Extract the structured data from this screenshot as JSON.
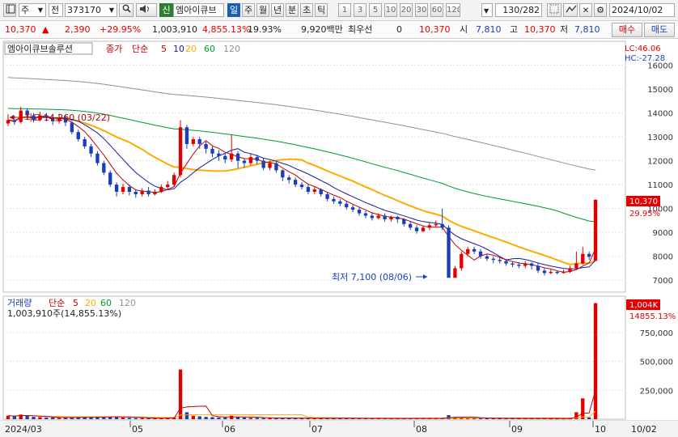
{
  "toolbar": {
    "market": "주",
    "scope": "전",
    "code": "373170",
    "badge": "신",
    "name": "엠아이큐브",
    "periods": [
      "일",
      "주",
      "월",
      "년",
      "분",
      "초",
      "틱"
    ],
    "counts": [
      "1",
      "3",
      "5",
      "10",
      "20",
      "30",
      "60",
      "120"
    ],
    "count_display": "130/282",
    "date": "2024/10/02"
  },
  "quote": {
    "price": "10,370",
    "change": "2,390",
    "change_pct": "+29.95%",
    "volume": "1,003,910",
    "volume_pct": "4,855.13%",
    "turnover": "19.93%",
    "amount": "9,920백만",
    "best_label": "최우선",
    "best_value": "0",
    "last": "10,370",
    "open_label": "시",
    "open": "7,810",
    "high_label": "고",
    "high": "10,370",
    "low_label": "저",
    "low": "7,810",
    "buy": "매수",
    "sell": "매도"
  },
  "chart_data": {
    "type": "candlestick",
    "title": "엠아이큐브솔루션",
    "legend": {
      "kind": "종가",
      "ma": "단순",
      "periods": [
        "5",
        "10",
        "20",
        "60",
        "120"
      ],
      "colors": [
        "#c00000",
        "#1a1aa0",
        "#ffaa00",
        "#009933",
        "#909090"
      ]
    },
    "lc": "LC:46.06",
    "hc": "HC:-27.28",
    "y_ticks": [
      7000,
      8000,
      9000,
      10000,
      11000,
      12000,
      13000,
      14000,
      15000,
      16000
    ],
    "ylim": [
      6500,
      17000
    ],
    "price_label": "10,370",
    "price_pct": "29.95%",
    "high_annotation": "최고 14,260 (03/22)",
    "low_annotation": "최저 7,100 (08/06)",
    "x_labels": [
      "2024/03",
      "05",
      "06",
      "07",
      "08",
      "09",
      "10",
      "10/02"
    ],
    "volume_panel": {
      "title": "거래량",
      "ma": "단순",
      "periods": [
        "5",
        "20",
        "60",
        "120"
      ],
      "colors": [
        "#c00000",
        "#ffaa00",
        "#009933",
        "#909090"
      ],
      "summary": "1,003,910주(14,855.13%)",
      "y_ticks": [
        "250,000",
        "500,000",
        "750,000"
      ],
      "tick_values": [
        250000,
        500000,
        750000
      ],
      "max_label": "1,004K",
      "max_pct": "14855.13%",
      "ylim": [
        0,
        1050000
      ]
    },
    "candles": [
      [
        13560,
        13700,
        13950,
        13450
      ],
      [
        13700,
        13620,
        13900,
        13500
      ],
      [
        13620,
        14100,
        14260,
        13550
      ],
      [
        14100,
        13900,
        14200,
        13700
      ],
      [
        13900,
        13700,
        14000,
        13600
      ],
      [
        13700,
        13900,
        14050,
        13650
      ],
      [
        13900,
        13800,
        14000,
        13650
      ],
      [
        13800,
        13650,
        13900,
        13500
      ],
      [
        13650,
        13800,
        13950,
        13550
      ],
      [
        13800,
        13600,
        13900,
        13450
      ],
      [
        13600,
        13200,
        13650,
        13100
      ],
      [
        13200,
        12900,
        13300,
        12800
      ],
      [
        12900,
        12600,
        13000,
        12500
      ],
      [
        12600,
        12300,
        12700,
        12150
      ],
      [
        12300,
        11900,
        12400,
        11800
      ],
      [
        11900,
        11500,
        12000,
        11400
      ],
      [
        11500,
        11000,
        11600,
        10900
      ],
      [
        11000,
        10700,
        11100,
        10500
      ],
      [
        10700,
        10900,
        11050,
        10600
      ],
      [
        10900,
        10700,
        11000,
        10550
      ],
      [
        10700,
        10600,
        10800,
        10450
      ],
      [
        10600,
        10750,
        10850,
        10500
      ],
      [
        10750,
        10600,
        10900,
        10500
      ],
      [
        10600,
        10700,
        10800,
        10550
      ],
      [
        10700,
        10900,
        11000,
        10650
      ],
      [
        10900,
        11000,
        11150,
        10800
      ],
      [
        11000,
        11400,
        11500,
        10900
      ],
      [
        11400,
        13400,
        13700,
        11300
      ],
      [
        13400,
        12700,
        13500,
        12500
      ],
      [
        12700,
        12900,
        13000,
        12600
      ],
      [
        12900,
        12700,
        13000,
        12500
      ],
      [
        12700,
        12500,
        12800,
        12300
      ],
      [
        12500,
        12300,
        12600,
        12150
      ],
      [
        12300,
        12200,
        12450,
        12000
      ],
      [
        12200,
        12050,
        12300,
        11900
      ],
      [
        12050,
        12300,
        13100,
        11950
      ],
      [
        12300,
        12000,
        12400,
        11700
      ],
      [
        12000,
        11900,
        12100,
        11700
      ],
      [
        11900,
        12150,
        12300,
        11800
      ],
      [
        12150,
        12000,
        12250,
        11850
      ],
      [
        12000,
        11700,
        12100,
        11600
      ],
      [
        11700,
        11900,
        12000,
        11600
      ],
      [
        11900,
        11600,
        12000,
        11500
      ],
      [
        11600,
        11300,
        11650,
        11150
      ],
      [
        11300,
        11200,
        11400,
        11050
      ],
      [
        11200,
        11000,
        11300,
        10900
      ],
      [
        11000,
        10900,
        11100,
        10800
      ],
      [
        10900,
        10700,
        11000,
        10600
      ],
      [
        10700,
        10800,
        10900,
        10600
      ],
      [
        10800,
        10600,
        10850,
        10500
      ],
      [
        10600,
        10400,
        10700,
        10300
      ],
      [
        10400,
        10300,
        10500,
        10200
      ],
      [
        10300,
        10200,
        10400,
        10100
      ],
      [
        10200,
        10050,
        10300,
        9950
      ],
      [
        10050,
        9950,
        10150,
        9850
      ],
      [
        9950,
        9800,
        10050,
        9700
      ],
      [
        9800,
        9700,
        9900,
        9600
      ],
      [
        9700,
        9600,
        9800,
        9500
      ],
      [
        9600,
        9700,
        9800,
        9550
      ],
      [
        9700,
        9550,
        9800,
        9450
      ],
      [
        9550,
        9650,
        9700,
        9450
      ],
      [
        9650,
        9550,
        9700,
        9400
      ],
      [
        9550,
        9350,
        9600,
        9250
      ],
      [
        9350,
        9200,
        9450,
        9100
      ],
      [
        9200,
        9050,
        9300,
        8950
      ],
      [
        9050,
        9200,
        9300,
        9000
      ],
      [
        9200,
        9300,
        9400,
        9100
      ],
      [
        9300,
        9350,
        9500,
        9200
      ],
      [
        9350,
        9200,
        10000,
        9100
      ],
      [
        9200,
        7100,
        9300,
        7100
      ],
      [
        7100,
        7500,
        7600,
        7100
      ],
      [
        7500,
        8100,
        8200,
        7400
      ],
      [
        8100,
        8300,
        8400,
        8000
      ],
      [
        8300,
        8200,
        8400,
        8100
      ],
      [
        8200,
        8000,
        8300,
        7900
      ],
      [
        8000,
        7900,
        8100,
        7800
      ],
      [
        7900,
        7850,
        8000,
        7700
      ],
      [
        7850,
        7800,
        7950,
        7700
      ],
      [
        7800,
        7700,
        7900,
        7600
      ],
      [
        7700,
        7650,
        7800,
        7550
      ],
      [
        7650,
        7600,
        7750,
        7500
      ],
      [
        7600,
        7700,
        7800,
        7500
      ],
      [
        7700,
        7600,
        7750,
        7450
      ],
      [
        7600,
        7400,
        7700,
        7300
      ],
      [
        7400,
        7300,
        7500,
        7200
      ],
      [
        7300,
        7350,
        7450,
        7250
      ],
      [
        7350,
        7300,
        7400,
        7250
      ],
      [
        7300,
        7350,
        7450,
        7280
      ],
      [
        7350,
        7500,
        7600,
        7300
      ],
      [
        7500,
        7700,
        8200,
        7450
      ],
      [
        7700,
        8100,
        8400,
        7650
      ],
      [
        8100,
        7980,
        8200,
        7850
      ],
      [
        7810,
        10370,
        10370,
        7810
      ]
    ],
    "volumes": [
      30000,
      25000,
      40000,
      30000,
      20000,
      18000,
      15000,
      15000,
      12000,
      12000,
      15000,
      18000,
      20000,
      15000,
      18000,
      20000,
      22000,
      25000,
      15000,
      12000,
      10000,
      10000,
      9000,
      8000,
      10000,
      12000,
      15000,
      430000,
      60000,
      30000,
      25000,
      20000,
      18000,
      15000,
      15000,
      30000,
      20000,
      15000,
      12000,
      12000,
      10000,
      10000,
      10000,
      12000,
      10000,
      9000,
      8000,
      9000,
      8000,
      8000,
      9000,
      9000,
      8000,
      8000,
      8000,
      8000,
      8000,
      7000,
      7000,
      7000,
      7000,
      7000,
      8000,
      8000,
      8000,
      7000,
      7000,
      9000,
      10000,
      35000,
      20000,
      15000,
      12000,
      10000,
      9000,
      8000,
      8000,
      8000,
      7000,
      7000,
      7000,
      7000,
      7000,
      8000,
      7000,
      6000,
      6000,
      6000,
      8000,
      60000,
      180000,
      15000,
      1003910
    ]
  }
}
